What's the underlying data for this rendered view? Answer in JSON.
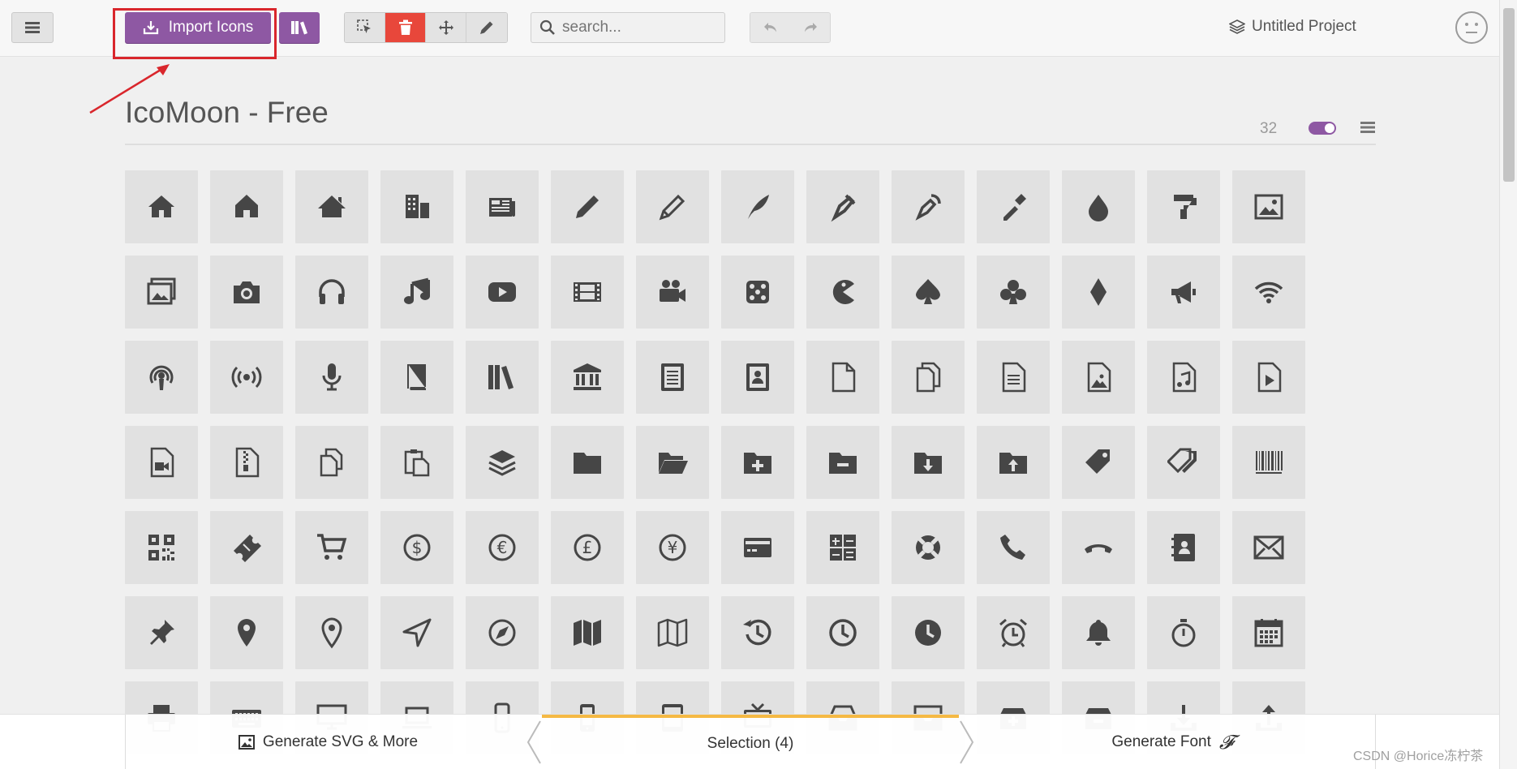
{
  "toolbar": {
    "import_label": "Import Icons",
    "search_placeholder": "search...",
    "project_label": "Untitled Project",
    "accent": "#8e58a3",
    "delete_color": "#e8473b"
  },
  "set": {
    "title": "IcoMoon - Free",
    "count": "32"
  },
  "grid": {
    "icons": [
      "home-icon",
      "home2-icon",
      "home3-icon",
      "office-icon",
      "newspaper-icon",
      "pencil-icon",
      "pencil2-icon",
      "quill-icon",
      "pen-icon",
      "blog-icon",
      "eyedropper-icon",
      "droplet-icon",
      "paint-format-icon",
      "image-icon",
      "images-icon",
      "camera-icon",
      "headphones-icon",
      "music-icon",
      "play-icon",
      "film-icon",
      "video-camera-icon",
      "dice-icon",
      "pacman-icon",
      "spades-icon",
      "clubs-icon",
      "diamonds-icon",
      "bullhorn-icon",
      "connection-icon",
      "podcast-icon",
      "feed-icon",
      "mic-icon",
      "book-icon",
      "books-icon",
      "library-icon",
      "file-text-icon",
      "profile-icon",
      "file-empty-icon",
      "files-empty-icon",
      "file-text2-icon",
      "file-picture-icon",
      "file-music-icon",
      "file-play-icon",
      "file-video-icon",
      "file-zip-icon",
      "copy-icon",
      "paste-icon",
      "stack-icon",
      "folder-icon",
      "folder-open-icon",
      "folder-plus-icon",
      "folder-minus-icon",
      "folder-download-icon",
      "folder-upload-icon",
      "price-tag-icon",
      "price-tags-icon",
      "barcode-icon",
      "qrcode-icon",
      "ticket-icon",
      "cart-icon",
      "coin-dollar-icon",
      "coin-euro-icon",
      "coin-pound-icon",
      "coin-yen-icon",
      "credit-card-icon",
      "calculator-icon",
      "lifebuoy-icon",
      "phone-icon",
      "phone-hang-up-icon",
      "address-book-icon",
      "envelop-icon",
      "pushpin-icon",
      "location-icon",
      "location2-icon",
      "compass-icon",
      "compass2-icon",
      "map-icon",
      "map2-icon",
      "history-icon",
      "clock-icon",
      "clock2-icon",
      "alarm-icon",
      "bell-icon",
      "stopwatch-icon",
      "calendar-icon",
      "printer-icon",
      "keyboard-icon",
      "display-icon",
      "laptop-icon",
      "mobile-icon",
      "mobile2-icon",
      "tablet-icon",
      "tv-icon",
      "drawer-icon",
      "drawer2-icon",
      "box-add-icon",
      "box-remove-icon",
      "download-icon",
      "upload-icon"
    ]
  },
  "bottom": {
    "generate_svg_label": "Generate SVG & More",
    "selection_label": "Selection (4)",
    "generate_font_label": "Generate Font",
    "font_glyph": "𝓕",
    "selection_accent": "#f5b944"
  },
  "watermark": "CSDN @Horice冻柠茶"
}
